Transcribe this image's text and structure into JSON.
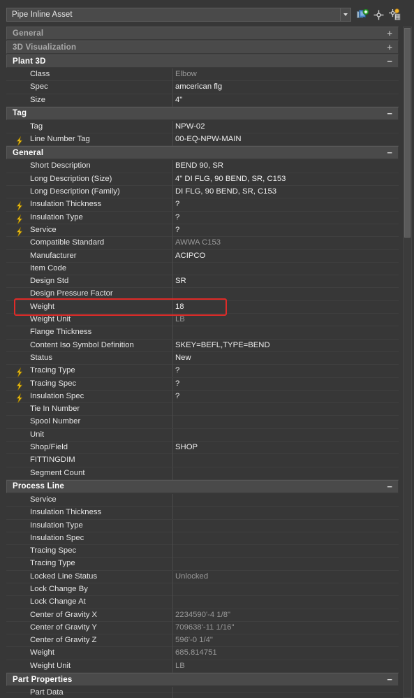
{
  "header": {
    "selector_value": "Pipe Inline Asset",
    "dropdown_icon": "chevron-down-icon",
    "buttons": [
      {
        "name": "quick-select-add-icon",
        "tooltip": "Select Similar"
      },
      {
        "name": "pick-points-crosshair-icon",
        "tooltip": "Pick Points"
      },
      {
        "name": "quick-select-filter-icon",
        "tooltip": "Quick Select"
      }
    ]
  },
  "colors": {
    "panel_bg": "#373737",
    "section_bg": "#4a4a4a",
    "row_divider": "#3f3f3f",
    "text": "#e6e6e6",
    "text_dim": "#9a9a9a",
    "bolt": "#f5c518",
    "annotation": "#e02b28"
  },
  "annotation": {
    "shape": "rectangle",
    "target_row": "Weight",
    "target_value": "18",
    "color": "#e02b28"
  },
  "sections": [
    {
      "title": "General",
      "state": "collapsed",
      "toggle": "+",
      "rows": []
    },
    {
      "title": "3D Visualization",
      "state": "collapsed",
      "toggle": "+",
      "rows": []
    },
    {
      "title": "Plant 3D",
      "state": "expanded",
      "toggle": "−",
      "rows": [
        {
          "name": "Class",
          "value": "Elbow",
          "dim": true,
          "bolt": false
        },
        {
          "name": "Spec",
          "value": "amcerican flg",
          "dim": false,
          "bolt": false
        },
        {
          "name": "Size",
          "value": "4\"",
          "dim": false,
          "bolt": false
        }
      ]
    },
    {
      "title": "Tag",
      "state": "expanded",
      "toggle": "−",
      "rows": [
        {
          "name": "Tag",
          "value": "NPW-02",
          "dim": false,
          "bolt": false
        },
        {
          "name": "Line Number Tag",
          "value": "00-EQ-NPW-MAIN",
          "dim": false,
          "bolt": true
        }
      ]
    },
    {
      "title": "General",
      "state": "expanded",
      "toggle": "−",
      "rows": [
        {
          "name": "Short Description",
          "value": "BEND 90, SR",
          "dim": false,
          "bolt": false
        },
        {
          "name": "Long Description (Size)",
          "value": "4\" DI FLG, 90 BEND, SR, C153",
          "dim": false,
          "bolt": false
        },
        {
          "name": "Long Description (Family)",
          "value": "DI FLG, 90 BEND, SR, C153",
          "dim": false,
          "bolt": false
        },
        {
          "name": "Insulation Thickness",
          "value": "?",
          "dim": false,
          "bolt": true
        },
        {
          "name": "Insulation Type",
          "value": "?",
          "dim": false,
          "bolt": true
        },
        {
          "name": "Service",
          "value": "?",
          "dim": false,
          "bolt": true
        },
        {
          "name": "Compatible Standard",
          "value": "AWWA C153",
          "dim": true,
          "bolt": false
        },
        {
          "name": "Manufacturer",
          "value": "ACIPCO",
          "dim": false,
          "bolt": false
        },
        {
          "name": "Item Code",
          "value": "",
          "dim": false,
          "bolt": false
        },
        {
          "name": "Design Std",
          "value": "SR",
          "dim": false,
          "bolt": false
        },
        {
          "name": "Design Pressure Factor",
          "value": "",
          "dim": false,
          "bolt": false
        },
        {
          "name": "Weight",
          "value": "18",
          "dim": false,
          "bolt": false,
          "highlighted": true
        },
        {
          "name": "Weight Unit",
          "value": "LB",
          "dim": true,
          "bolt": false
        },
        {
          "name": "Flange Thickness",
          "value": "",
          "dim": false,
          "bolt": false
        },
        {
          "name": "Content Iso Symbol Definition",
          "value": "SKEY=BEFL,TYPE=BEND",
          "dim": false,
          "bolt": false
        },
        {
          "name": "Status",
          "value": "New",
          "dim": false,
          "bolt": false
        },
        {
          "name": "Tracing Type",
          "value": "?",
          "dim": false,
          "bolt": true
        },
        {
          "name": "Tracing Spec",
          "value": "?",
          "dim": false,
          "bolt": true
        },
        {
          "name": "Insulation Spec",
          "value": "?",
          "dim": false,
          "bolt": true
        },
        {
          "name": "Tie In Number",
          "value": "",
          "dim": false,
          "bolt": false
        },
        {
          "name": "Spool Number",
          "value": "",
          "dim": false,
          "bolt": false
        },
        {
          "name": "Unit",
          "value": "",
          "dim": false,
          "bolt": false
        },
        {
          "name": "Shop/Field",
          "value": "SHOP",
          "dim": false,
          "bolt": false
        },
        {
          "name": "FITTINGDIM",
          "value": "",
          "dim": false,
          "bolt": false
        },
        {
          "name": "Segment Count",
          "value": "",
          "dim": false,
          "bolt": false
        }
      ]
    },
    {
      "title": "Process Line",
      "state": "expanded",
      "toggle": "−",
      "rows": [
        {
          "name": "Service",
          "value": "",
          "dim": false,
          "bolt": false
        },
        {
          "name": "Insulation Thickness",
          "value": "",
          "dim": false,
          "bolt": false
        },
        {
          "name": "Insulation Type",
          "value": "",
          "dim": false,
          "bolt": false
        },
        {
          "name": "Insulation Spec",
          "value": "",
          "dim": false,
          "bolt": false
        },
        {
          "name": "Tracing Spec",
          "value": "",
          "dim": false,
          "bolt": false
        },
        {
          "name": "Tracing Type",
          "value": "",
          "dim": false,
          "bolt": false
        },
        {
          "name": "Locked Line Status",
          "value": "Unlocked",
          "dim": true,
          "bolt": false
        },
        {
          "name": "Lock Change By",
          "value": "",
          "dim": false,
          "bolt": false
        },
        {
          "name": "Lock Change At",
          "value": "",
          "dim": false,
          "bolt": false
        },
        {
          "name": "Center of Gravity X",
          "value": "2234590'-4 1/8\"",
          "dim": true,
          "bolt": false
        },
        {
          "name": "Center of Gravity Y",
          "value": "709638'-11 1/16\"",
          "dim": true,
          "bolt": false
        },
        {
          "name": "Center of Gravity Z",
          "value": "596'-0 1/4\"",
          "dim": true,
          "bolt": false
        },
        {
          "name": "Weight",
          "value": "685.814751",
          "dim": true,
          "bolt": false
        },
        {
          "name": "Weight Unit",
          "value": "LB",
          "dim": true,
          "bolt": false
        }
      ]
    },
    {
      "title": "Part Properties",
      "state": "expanded",
      "toggle": "−",
      "rows": [
        {
          "name": "Part Data",
          "value": "",
          "dim": false,
          "bolt": false,
          "clipped": true
        }
      ]
    }
  ]
}
